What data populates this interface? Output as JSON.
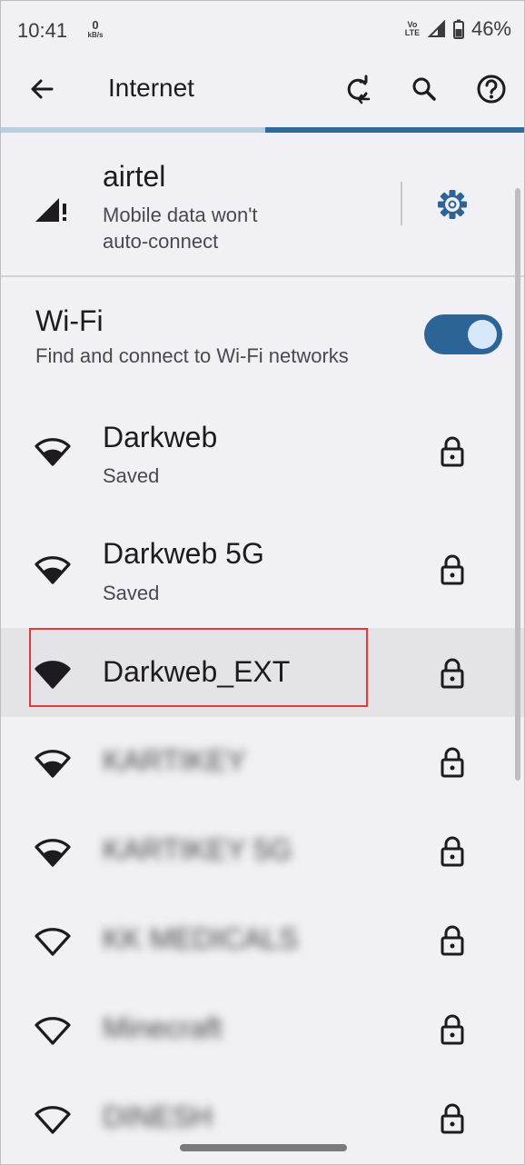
{
  "status_bar": {
    "time": "10:41",
    "speed_value": "0",
    "speed_unit": "kB/s",
    "volte_top": "Vo",
    "volte_bottom": "LTE",
    "battery": "46%"
  },
  "app_bar": {
    "title": "Internet",
    "icons": [
      "back-arrow-icon",
      "refresh-icon",
      "search-icon",
      "help-icon"
    ]
  },
  "progress_fraction": 0.5,
  "mobile": {
    "carrier": "airtel",
    "status_line1": "Mobile data won't",
    "status_line2": "auto-connect",
    "settings_icon": "gear-icon"
  },
  "wifi": {
    "title": "Wi-Fi",
    "subtitle": "Find and connect to Wi-Fi networks",
    "enabled": true
  },
  "networks": [
    {
      "name": "Darkweb",
      "status": "Saved",
      "icon": "wifi-signal-icon",
      "locked": true,
      "blurred": false,
      "selected": false
    },
    {
      "name": "Darkweb 5G",
      "status": "Saved",
      "icon": "wifi-signal-icon",
      "locked": true,
      "blurred": false,
      "selected": false
    },
    {
      "name": "Darkweb_EXT",
      "status": "",
      "icon": "wifi-full-icon",
      "locked": true,
      "blurred": false,
      "selected": true
    },
    {
      "name": "KARTIKEY",
      "status": "",
      "icon": "wifi-signal-icon",
      "locked": true,
      "blurred": true,
      "selected": false
    },
    {
      "name": "KARTIKEY 5G",
      "status": "",
      "icon": "wifi-signal-icon",
      "locked": true,
      "blurred": true,
      "selected": false
    },
    {
      "name": "KK MEDICALS",
      "status": "",
      "icon": "wifi-weak-icon",
      "locked": true,
      "blurred": true,
      "selected": false
    },
    {
      "name": "Minecraft",
      "status": "",
      "icon": "wifi-weak-icon",
      "locked": true,
      "blurred": true,
      "selected": false
    },
    {
      "name": "DINESH",
      "status": "",
      "icon": "wifi-weak-icon",
      "locked": true,
      "blurred": true,
      "selected": false
    }
  ],
  "colors": {
    "accent": "#2c6497",
    "background": "#f1f0f5",
    "highlight": "#e33b3b"
  }
}
